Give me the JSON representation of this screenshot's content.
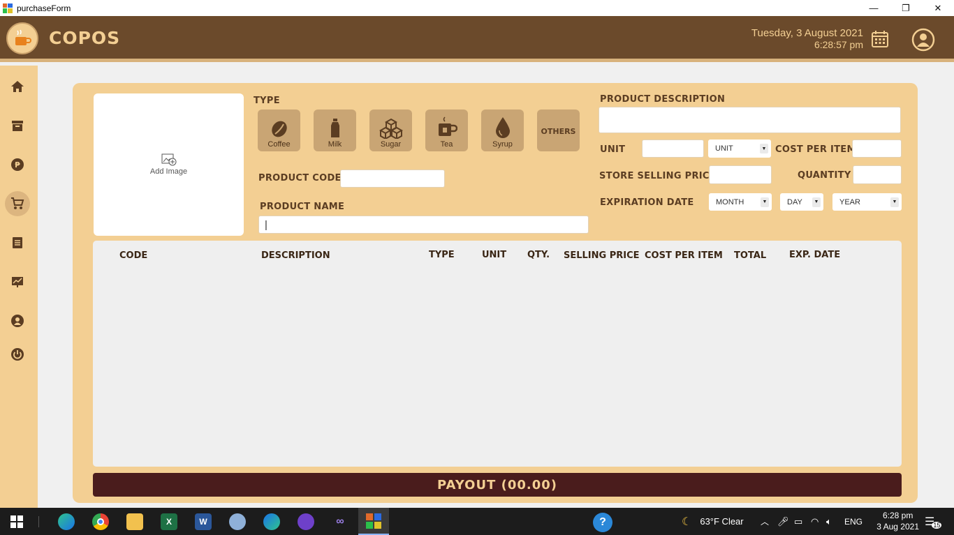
{
  "window": {
    "title": "purchaseForm",
    "minimize": "—",
    "restore": "❐",
    "close": "✕"
  },
  "header": {
    "brand": "COPOS",
    "date": "Tuesday, 3 August 2021",
    "time": "6:28:57 pm"
  },
  "colors": {
    "header_bg": "#6b4a2b",
    "accent": "#f3cf93",
    "payout_bg": "#4a1c1c",
    "button_bg": "#c9a574"
  },
  "sidebar": {
    "items": [
      {
        "name": "home",
        "icon": "home-icon"
      },
      {
        "name": "inventory",
        "icon": "box-icon"
      },
      {
        "name": "sales",
        "icon": "coin-icon"
      },
      {
        "name": "purchase",
        "icon": "cart-icon",
        "active": true
      },
      {
        "name": "records",
        "icon": "ledger-icon"
      },
      {
        "name": "reports",
        "icon": "chart-icon"
      },
      {
        "name": "users",
        "icon": "user-icon"
      },
      {
        "name": "logout",
        "icon": "power-icon"
      }
    ]
  },
  "form": {
    "add_image": "Add Image",
    "type_label": "TYPE",
    "types": [
      {
        "label": "Coffee",
        "icon": "coffee-bean-icon"
      },
      {
        "label": "Milk",
        "icon": "milk-bottle-icon"
      },
      {
        "label": "Sugar",
        "icon": "sugar-cubes-icon"
      },
      {
        "label": "Tea",
        "icon": "tea-cup-icon"
      },
      {
        "label": "Syrup",
        "icon": "drop-icon"
      },
      {
        "label": "OTHERS",
        "icon": ""
      }
    ],
    "product_code_label": "PRODUCT CODE",
    "product_code_value": "",
    "product_name_label": "PRODUCT NAME",
    "product_name_value": "|",
    "product_description_label": "PRODUCT DESCRIPTION",
    "product_description_value": "",
    "unit_label": "UNIT",
    "unit_value": "",
    "unit_select": "UNIT",
    "cost_per_item_label": "COST PER ITEM",
    "cost_per_item_value": "",
    "store_selling_price_label": "STORE SELLING PRICE",
    "store_selling_price_value": "",
    "quantity_label": "QUANTITY",
    "quantity_value": "",
    "expiration_date_label": "EXPIRATION DATE",
    "month_select": "MONTH",
    "day_select": "DAY",
    "year_select": "YEAR"
  },
  "table": {
    "columns": [
      "CODE",
      "DESCRIPTION",
      "TYPE",
      "UNIT",
      "QTY.",
      "SELLING PRICE",
      "COST PER ITEM",
      "TOTAL",
      "EXP. DATE"
    ],
    "rows": []
  },
  "payout_label": "PAYOUT (00.00)",
  "taskbar": {
    "weather": "63°F  Clear",
    "language": "ENG",
    "time": "6:28 pm",
    "date": "3 Aug 2021",
    "notifications": "15",
    "apps": [
      "start",
      "edge",
      "chrome",
      "file-explorer",
      "excel",
      "word",
      "paint",
      "edge-beta",
      "github-desktop",
      "visual-studio",
      "purchaseForm"
    ]
  }
}
